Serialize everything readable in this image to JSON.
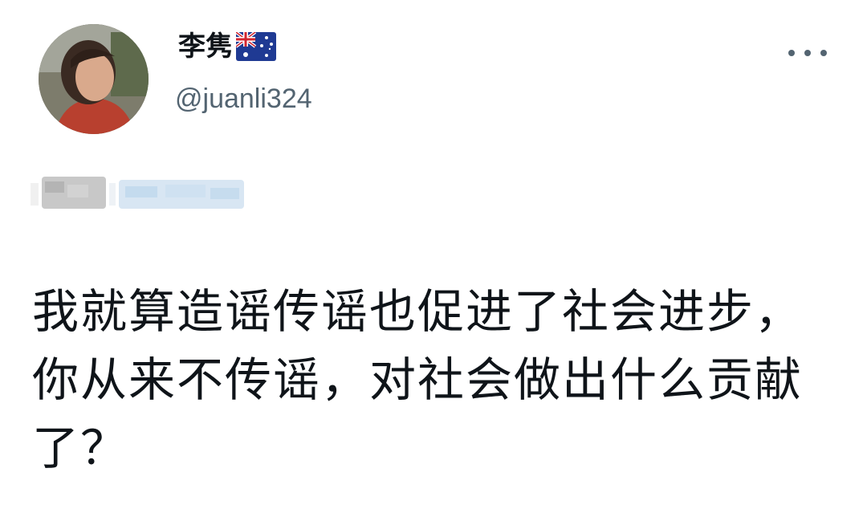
{
  "user": {
    "display_name": "李隽",
    "handle": "@juanli324",
    "flag_icon": "australia-flag-icon",
    "avatar_icon": "profile-photo"
  },
  "menu": {
    "icon": "more-options-icon"
  },
  "reply_context": {
    "state": "blurred"
  },
  "tweet": {
    "text": "我就算造谣传谣也促进了社会进步，你从来不传谣，对社会做出什么贡献了？"
  },
  "colors": {
    "text_primary": "#0f1419",
    "text_secondary": "#536471",
    "background": "#ffffff"
  }
}
